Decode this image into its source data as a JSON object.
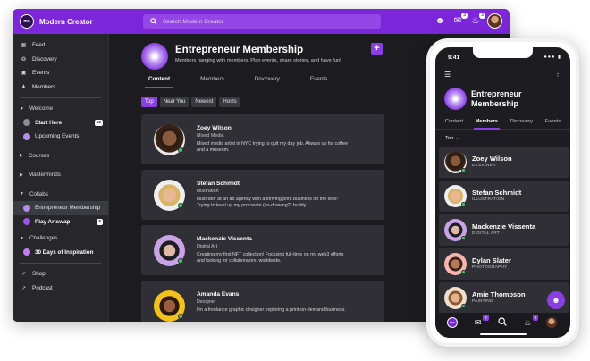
{
  "app": {
    "logo_text": "mc",
    "name": "Modern Creator"
  },
  "search": {
    "placeholder": "Search Modern Creator"
  },
  "topbar": {
    "messages_badge": "3",
    "notifications_badge": "3"
  },
  "sidebar": {
    "main_items": [
      {
        "label": "Feed",
        "icon": "feed-icon"
      },
      {
        "label": "Discovery",
        "icon": "compass-icon"
      },
      {
        "label": "Events",
        "icon": "calendar-icon"
      },
      {
        "label": "Members",
        "icon": "members-icon"
      }
    ],
    "welcome": {
      "label": "Welcome",
      "items": [
        {
          "label": "Start Here",
          "count": "12"
        },
        {
          "label": "Upcoming Events",
          "count": ""
        }
      ]
    },
    "courses": {
      "label": "Courses"
    },
    "masterminds": {
      "label": "Masterminds"
    },
    "collabs": {
      "label": "Collabs",
      "items": [
        {
          "label": "Entrepreneur Membership",
          "count": ""
        },
        {
          "label": "Play Artswap",
          "count": "5"
        }
      ]
    },
    "challenges": {
      "label": "Challenges",
      "items": [
        {
          "label": "30 Days of Inspiration",
          "count": ""
        }
      ]
    },
    "links": [
      {
        "label": "Shop",
        "icon": "external-link-icon"
      },
      {
        "label": "Podcast",
        "icon": "external-link-icon"
      }
    ]
  },
  "group": {
    "title": "Entrepreneur Membership",
    "description": "Members hanging with members. Plan events, share stories, and have fun!",
    "tabs": [
      "Content",
      "Members",
      "Discovery",
      "Events"
    ],
    "filters": [
      "Top",
      "Near You",
      "Newest",
      "Hosts"
    ]
  },
  "members": [
    {
      "name": "Zoey Wilson",
      "role": "Mixed Media",
      "bio": "Mixed media artist in NYC trying to quit my day job. Always up for coffee and a museum."
    },
    {
      "name": "Stefan Schmidt",
      "role": "Illustration",
      "bio": "Illustrator at an ad agency with a thriving print business on the side! Trying to level up my procreate (co-drawing?) buddy..."
    },
    {
      "name": "Mackenzie Vissenta",
      "role": "Digital Art",
      "bio": "Creating my first NFT collection! Focusing full-time on my web3 efforts and looking for collaborators, worldwide."
    },
    {
      "name": "Amanda Evans",
      "role": "Designer",
      "bio": "I'm a freelance graphic designer exploring a print-on-demand business."
    }
  ],
  "phone": {
    "time": "9:41",
    "title": "Entrepreneur Membership",
    "tabs": [
      "Content",
      "Members",
      "Discovery",
      "Events"
    ],
    "sort_label": "Top",
    "members": [
      {
        "name": "Zoey Wilson",
        "role": "DESIGNER"
      },
      {
        "name": "Stefan Schmidt",
        "role": "ILLUSTRATION"
      },
      {
        "name": "Mackenzie Vissenta",
        "role": "DIGITAL ART"
      },
      {
        "name": "Dylan Slater",
        "role": "PHOTOGRAPHY"
      },
      {
        "name": "Amie Thompson",
        "role": "PAINTING"
      }
    ],
    "nav_messages_badge": "3",
    "nav_notifications_badge": "3"
  },
  "colors": {
    "brand": "#7b27d9",
    "accent": "#8a3fe0",
    "online": "#3ccf6a"
  }
}
